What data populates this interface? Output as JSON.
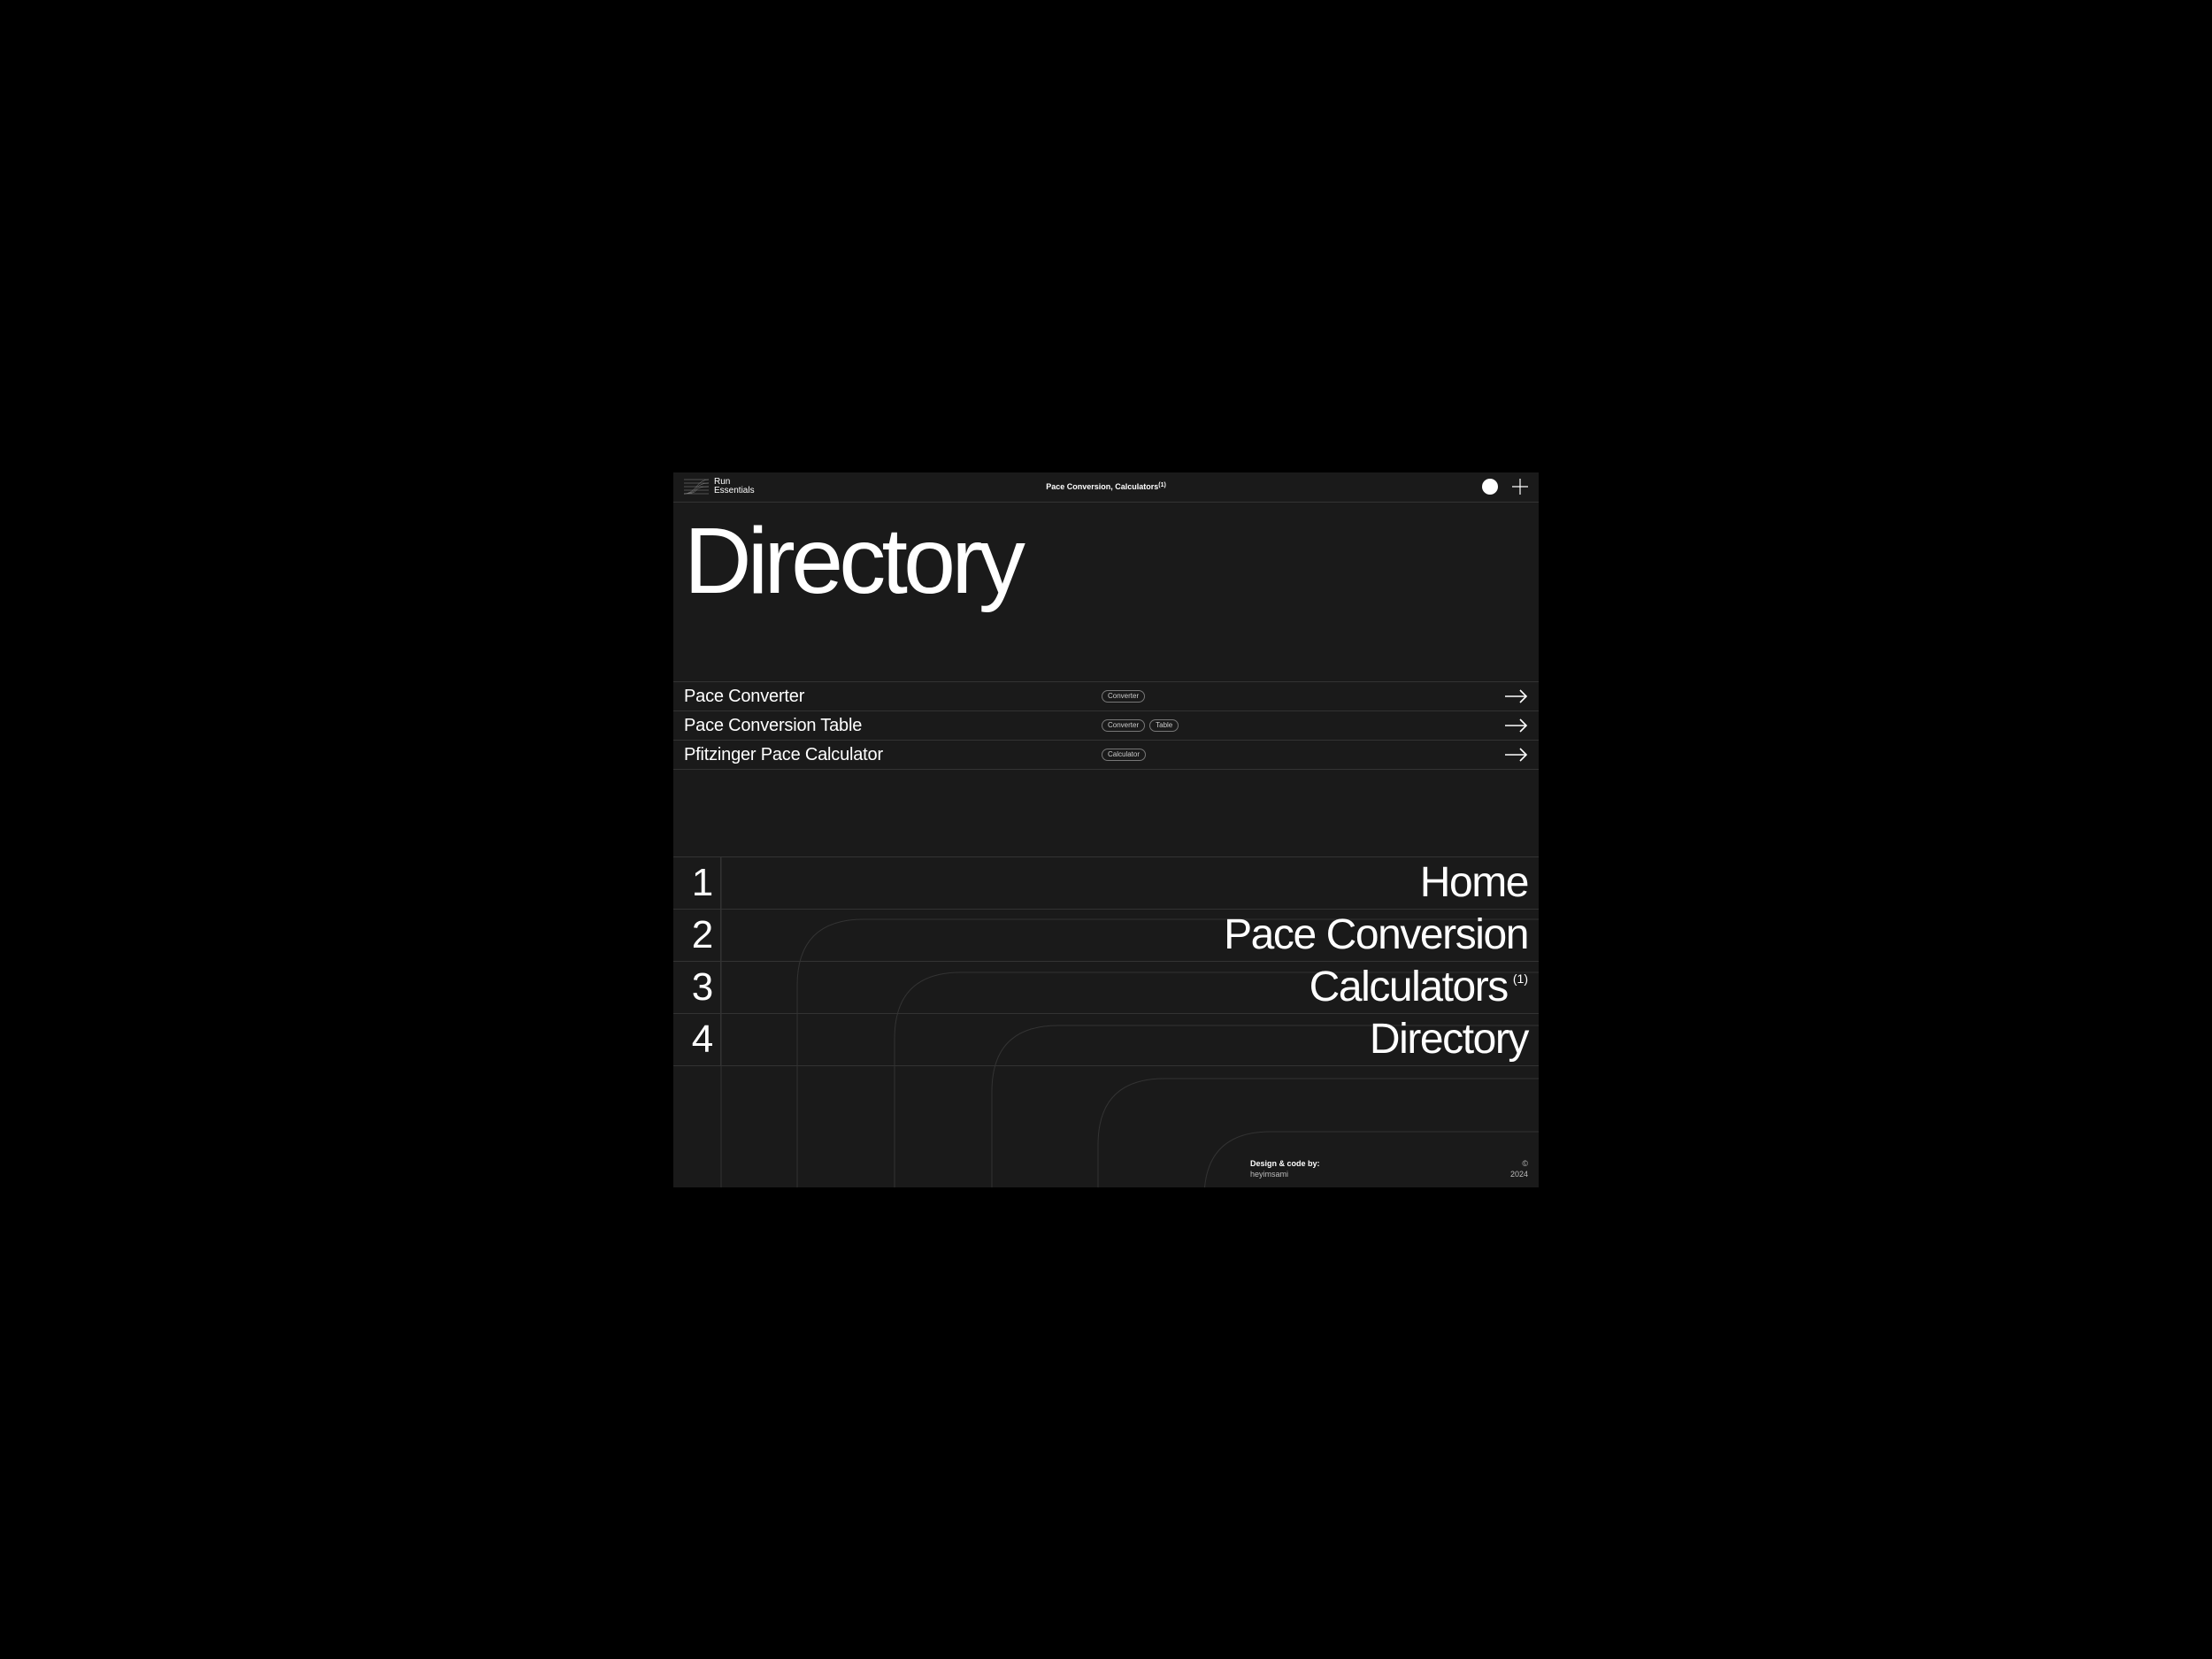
{
  "header": {
    "logo_line1": "Run",
    "logo_line2": "Essentials",
    "center_label": "Pace Conversion, Calculators",
    "center_sup": "(1)"
  },
  "page_title": "Directory",
  "dir_items": [
    {
      "name": "Pace Converter",
      "tags": [
        "Converter"
      ]
    },
    {
      "name": "Pace Conversion Table",
      "tags": [
        "Converter",
        "Table"
      ]
    },
    {
      "name": "Pfitzinger Pace Calculator",
      "tags": [
        "Calculator"
      ]
    }
  ],
  "nav_items": [
    {
      "num": "1",
      "label": "Home",
      "sup": ""
    },
    {
      "num": "2",
      "label": "Pace Conversion",
      "sup": ""
    },
    {
      "num": "3",
      "label": "Calculators",
      "sup": "(1)"
    },
    {
      "num": "4",
      "label": "Directory",
      "sup": ""
    }
  ],
  "footer": {
    "by_label": "Design & code by:",
    "author": "heyimsami",
    "copyright": "©",
    "year": "2024"
  }
}
